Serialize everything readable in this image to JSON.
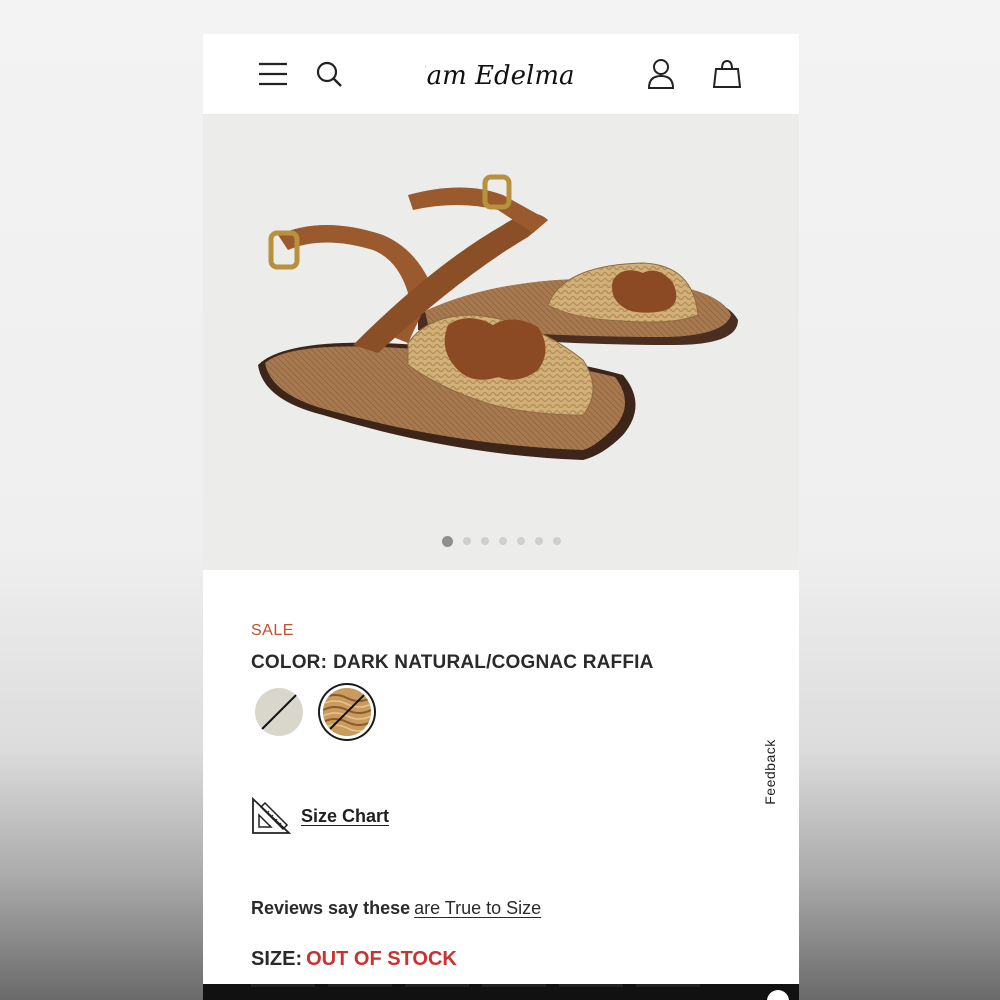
{
  "status_bar": {
    "time_fragment": ""
  },
  "header": {
    "brand": "Sam Edelman",
    "icons": [
      "menu-icon",
      "search-icon",
      "account-icon",
      "cart-icon"
    ]
  },
  "gallery": {
    "image_description": "Raffia ankle-strap sandals with cognac leather logo",
    "dot_count": 7,
    "active_dot": 1
  },
  "product": {
    "badge": "SALE",
    "color_label": "COLOR:",
    "color_value": "DARK NATURAL/COGNAC RAFFIA",
    "swatches": [
      {
        "name": "light-natural",
        "unavailable": true,
        "selected": false
      },
      {
        "name": "dark-natural-cognac-raffia",
        "unavailable": true,
        "selected": true
      }
    ],
    "size_chart_label": "Size Chart",
    "reviews_lead": "Reviews say these",
    "reviews_link": "are True to Size",
    "size_label": "SIZE:",
    "size_status": "OUT OF STOCK"
  },
  "feedback_tab": "Feedback",
  "colors": {
    "sale": "#c4502f",
    "out_of_stock": "#c8322f",
    "text": "#2a2a2a"
  }
}
